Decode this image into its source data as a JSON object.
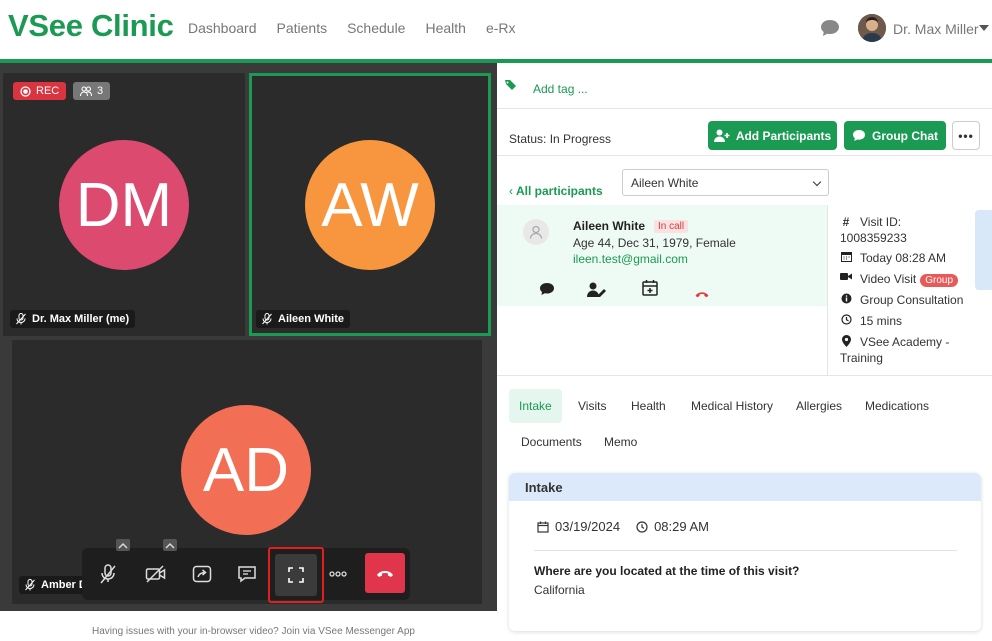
{
  "header": {
    "logo": "VSee Clinic",
    "nav": [
      "Dashboard",
      "Patients",
      "Schedule",
      "Health",
      "e-Rx"
    ],
    "user_name": "Dr. Max Miller"
  },
  "video": {
    "rec_label": "REC",
    "participant_count": "3",
    "tiles": [
      {
        "initials": "DM",
        "name": "Dr. Max Miller (me)",
        "color": "#dd4a6f"
      },
      {
        "initials": "AW",
        "name": "Aileen White",
        "color": "#f7963e"
      },
      {
        "initials": "AD",
        "name": "Amber D",
        "color": "#f26e55"
      }
    ],
    "footer_note": "Having issues with your in-browser video? Join via VSee Messenger App"
  },
  "panel": {
    "add_tag": "Add tag ...",
    "status": "Status: In Progress",
    "add_participants": "Add Participants",
    "group_chat": "Group Chat",
    "more": "•••",
    "all_participants": "All participants",
    "selected_participant": "Aileen White",
    "patient": {
      "name": "Aileen White",
      "badge": "In call",
      "info": "Age 44, Dec 31, 1979, Female",
      "email": "ileen.test@gmail.com"
    },
    "visit": {
      "id_label": "Visit ID:",
      "id_value": "1008359233",
      "time": "Today 08:28 AM",
      "type": "Video Visit",
      "type_badge": "Group",
      "consult": "Group Consultation",
      "duration": "15 mins",
      "location_1": "VSee Academy -",
      "location_2": "Training"
    },
    "tabs": [
      "Intake",
      "Visits",
      "Health",
      "Medical History",
      "Allergies",
      "Medications",
      "Documents",
      "Memo"
    ],
    "intake": {
      "title": "Intake",
      "date": "03/19/2024",
      "time": "08:29 AM",
      "question": "Where are you located at the time of this visit?",
      "answer": "California"
    }
  },
  "colors": {
    "brand_green": "#1a9a52",
    "rec_red": "#d9343f",
    "hangup_red": "#e0354a",
    "highlight_red": "#e02020"
  }
}
